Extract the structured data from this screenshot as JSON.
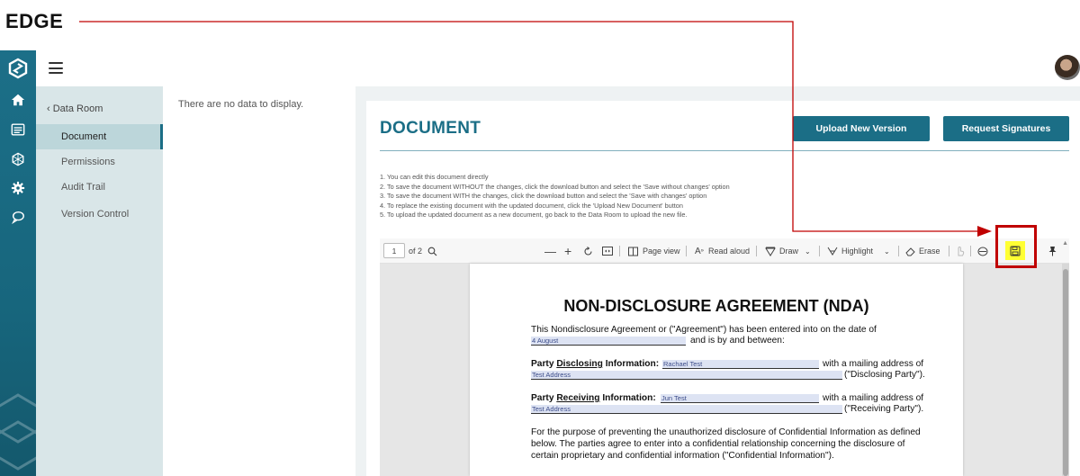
{
  "annotation": {
    "label": "EDGE"
  },
  "rail": {
    "icons": [
      "home-icon",
      "list-icon",
      "network-icon",
      "gear-icon",
      "chat-icon"
    ]
  },
  "subnav": {
    "back_label": "‹ Data Room",
    "items": [
      {
        "label": "Document",
        "active": true
      },
      {
        "label": "Permissions",
        "active": false
      },
      {
        "label": "Audit Trail",
        "active": false
      },
      {
        "label": "Version Control",
        "active": false
      }
    ]
  },
  "listcol": {
    "empty_text": "There are no data to display."
  },
  "document": {
    "title": "DOCUMENT",
    "upload_button": "Upload New Version",
    "request_button": "Request Signatures",
    "instructions": [
      "1. You can edit this document directly",
      "2. To save the document WITHOUT the changes, click the download button and select the 'Save without changes' option",
      "3. To save the document WITH the changes, click the download button and select the 'Save with changes' option",
      "4. To replace the existing document with the updated document, click the 'Upload New Document' button",
      "5. To upload the updated document as a new document, go back to the Data Room to upload the new file."
    ]
  },
  "viewer": {
    "page_number": "1",
    "page_count": "of 2",
    "page_view_label": "Page view",
    "read_aloud_label": "Read aloud",
    "draw_label": "Draw",
    "highlight_label": "Highlight",
    "erase_label": "Erase"
  },
  "nda": {
    "title": "NON-DISCLOSURE AGREEMENT (NDA)",
    "intro_line1": "This Nondisclosure Agreement or (\"Agreement\") has been entered into on the date of",
    "date_value": "4 August",
    "intro_line2": "and is by and between:",
    "disclosing_prefix": "Party",
    "disclosing_word": "Disclosing",
    "disclosing_suffix": "Information:",
    "disclosing_name": "Rachael Test",
    "disclosing_mail": "with a mailing address of",
    "disclosing_address": "Test Address",
    "disclosing_party": "(\"Disclosing Party\").",
    "receiving_prefix": "Party",
    "receiving_word": "Receiving",
    "receiving_suffix": "Information:",
    "receiving_name": "Jun Test",
    "receiving_mail": "with a mailing address of",
    "receiving_address": "Test Address",
    "receiving_party": "(\"Receiving Party\").",
    "purpose_line1": "For the purpose of preventing the unauthorized disclosure of Confidential Information as defined",
    "purpose_line2": "below. The parties agree to enter into a confidential relationship concerning the disclosure of",
    "purpose_line3": "certain proprietary and confidential information (\"Confidential Information\")."
  },
  "colors": {
    "brand": "#1b6e86",
    "subnav_bg": "#d9e6e8",
    "highlight": "#ffff33",
    "annotation_red": "#c00000"
  }
}
